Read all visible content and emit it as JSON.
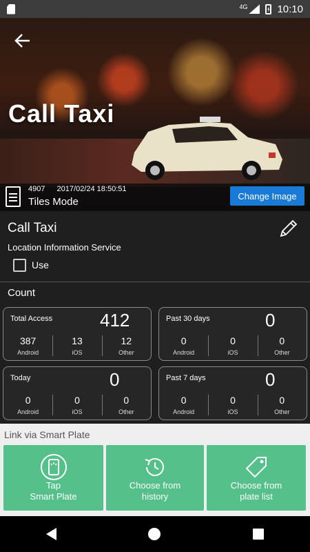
{
  "status_bar": {
    "time": "10:10",
    "network": "4G"
  },
  "hero": {
    "title": "Call Taxi",
    "id": "4907",
    "timestamp": "2017/02/24 18:50:51",
    "mode": "Tiles Mode",
    "change_image_label": "Change Image"
  },
  "service": {
    "title": "Call Taxi",
    "location_label": "Location Information Service",
    "use_label": "Use",
    "use_checked": false
  },
  "count": {
    "label": "Count",
    "cards": [
      {
        "caption": "Total Access",
        "total": "412",
        "android": "387",
        "ios": "13",
        "other": "12"
      },
      {
        "caption": "Past 30 days",
        "total": "0",
        "android": "0",
        "ios": "0",
        "other": "0"
      },
      {
        "caption": "Today",
        "total": "0",
        "android": "0",
        "ios": "0",
        "other": "0"
      },
      {
        "caption": "Past 7 days",
        "total": "0",
        "android": "0",
        "ios": "0",
        "other": "0"
      }
    ],
    "col_labels": {
      "android": "Android",
      "ios": "iOS",
      "other": "Other"
    }
  },
  "smart_plate": {
    "title": "Link via Smart Plate",
    "tiles": [
      {
        "line1": "Tap",
        "line2": "Smart Plate",
        "icon": "tap-phone-icon"
      },
      {
        "line1": "Choose from",
        "line2": "history",
        "icon": "history-icon"
      },
      {
        "line1": "Choose from",
        "line2": "plate list",
        "icon": "tag-icon"
      }
    ]
  },
  "colors": {
    "accent_button": "#1a7bd6",
    "tile_green": "#56c08b"
  }
}
